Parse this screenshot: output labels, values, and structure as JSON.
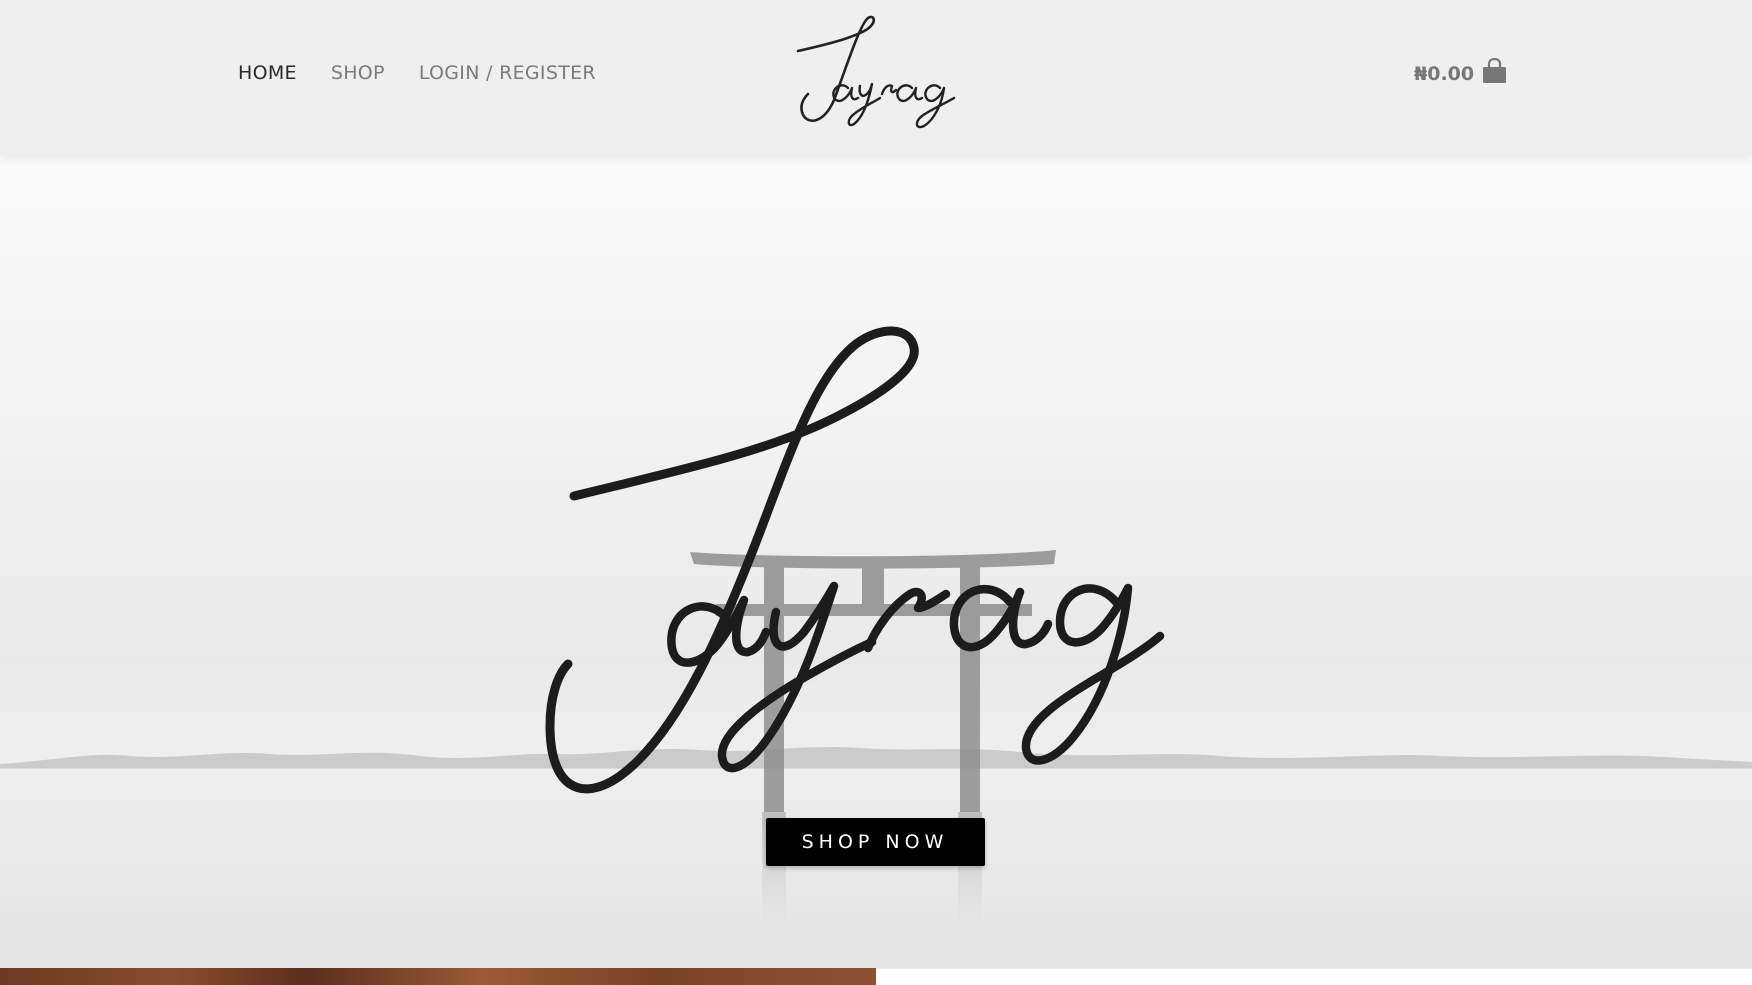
{
  "nav": {
    "items": [
      {
        "label": "HOME",
        "active": true
      },
      {
        "label": "SHOP",
        "active": false
      },
      {
        "label": "LOGIN / REGISTER",
        "active": false
      }
    ]
  },
  "brand": {
    "logo_text": "Jayrag"
  },
  "cart": {
    "total": "₦0.00",
    "icon": "shopping-bag-icon"
  },
  "hero": {
    "cta_label": "SHOP NOW",
    "logo_text": "Jayrag"
  },
  "colors": {
    "header_bg": "#efefef",
    "nav_active": "#2a2a2a",
    "nav_inactive": "#7b7b7b",
    "cta_bg": "#000000",
    "cta_text": "#ffffff"
  }
}
